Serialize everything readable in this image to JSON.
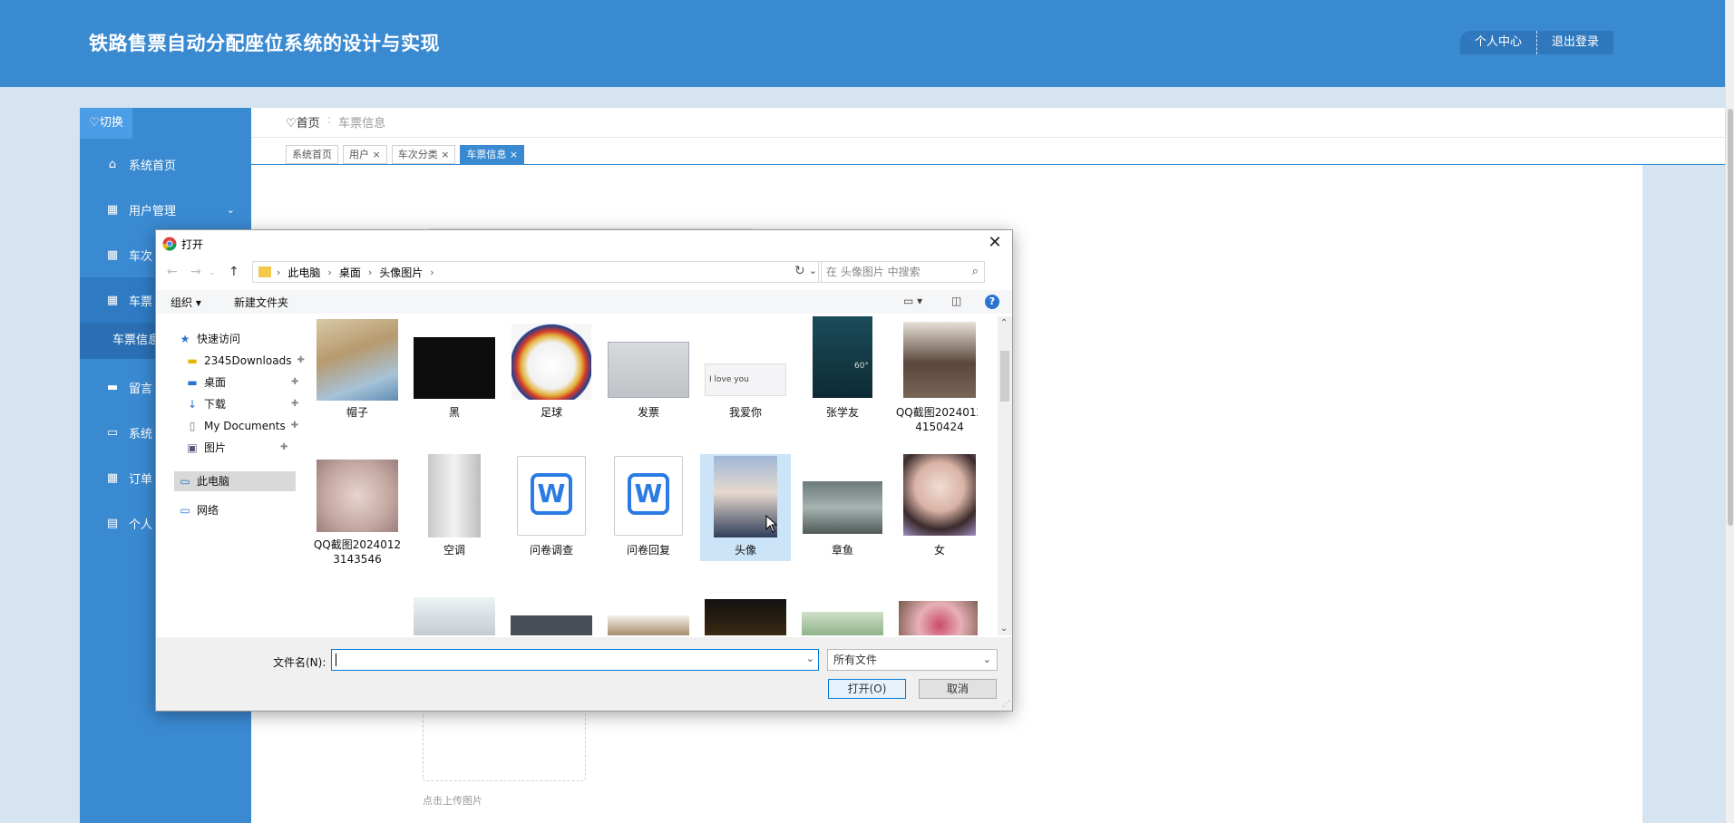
{
  "header": {
    "title": "铁路售票自动分配座位系统的设计与实现",
    "personal_center": "个人中心",
    "logout": "退出登录"
  },
  "sidebar": {
    "switch_label": "切换",
    "items": [
      {
        "label": "系统首页",
        "icon": "home-icon"
      },
      {
        "label": "用户管理",
        "icon": "grid-icon"
      },
      {
        "label": "车次",
        "icon": "grid-icon"
      },
      {
        "label": "车票",
        "icon": "grid-icon"
      },
      {
        "label": "留言",
        "icon": "comment-icon"
      },
      {
        "label": "系统",
        "icon": "monitor-icon"
      },
      {
        "label": "订单",
        "icon": "grid-icon"
      },
      {
        "label": "个人",
        "icon": "card-icon"
      }
    ],
    "sub_item": "车票信息"
  },
  "main": {
    "breadcrumb": {
      "home": "首页",
      "current": "车票信息"
    },
    "tabs": [
      {
        "label": "系统首页"
      },
      {
        "label": "用户 ×"
      },
      {
        "label": "车次分类 ×"
      },
      {
        "label": "车票信息 ×"
      }
    ],
    "upload_label": "点击上传图片"
  },
  "dialog": {
    "title": "打开",
    "address": {
      "seg1": "此电脑",
      "seg2": "桌面",
      "seg3": "头像图片",
      "sep": "›"
    },
    "search_placeholder": "在 头像图片 中搜索",
    "toolbar": {
      "organize": "组织 ▾",
      "new_folder": "新建文件夹"
    },
    "nav_pane": {
      "quick_access": "快速访问",
      "items": [
        "2345Downloads",
        "桌面",
        "下载",
        "My Documents",
        "图片"
      ],
      "this_pc": "此电脑",
      "network": "网络"
    },
    "files": [
      {
        "name": "帽子"
      },
      {
        "name": "黑"
      },
      {
        "name": "足球"
      },
      {
        "name": "发票"
      },
      {
        "name": "我爱你",
        "thumb_text": "I love you"
      },
      {
        "name": "张学友",
        "thumb_text": "60°"
      },
      {
        "name": "QQ截图20240124150424"
      },
      {
        "name": "QQ截图20240123143546"
      },
      {
        "name": "空调"
      },
      {
        "name": "问卷调查"
      },
      {
        "name": "问卷回复"
      },
      {
        "name": "头像"
      },
      {
        "name": "章鱼"
      },
      {
        "name": "女"
      }
    ],
    "filename_label": "文件名(N):",
    "filename_value": "",
    "filetype": "所有文件",
    "open_button": "打开(O)",
    "cancel_button": "取消"
  }
}
